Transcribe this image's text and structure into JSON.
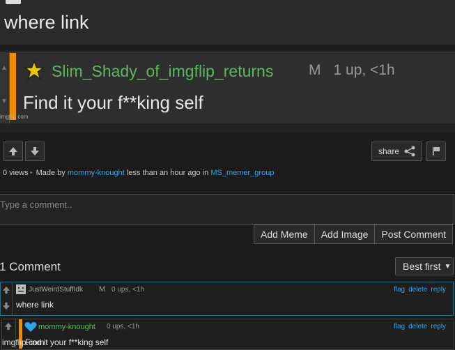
{
  "meme": {
    "top_text": "where link",
    "comment_user": "Slim_Shady_of_imgflip_returns",
    "comment_mod": "M",
    "comment_meta": "1 up, <1h",
    "comment_text": "Find it your f**king self",
    "watermark": "imgflip.com"
  },
  "actions": {
    "share_label": "share"
  },
  "meta": {
    "views": "0 views",
    "made_by_prefix": "Made by",
    "author": "mommy-knought",
    "time": "less than an hour ago in",
    "stream": "MS_memer_group"
  },
  "comment_box": {
    "placeholder": "Type a comment..",
    "buttons": [
      "Add Meme",
      "Add Image",
      "Post Comment"
    ]
  },
  "comments_header": {
    "count_label": "1 Comment",
    "sort_label": "Best first"
  },
  "comments": [
    {
      "user": "JustWeirdStuffIdk",
      "mod": "M",
      "meta": "0 ups, <1h",
      "text": "where link",
      "actions": [
        "flag",
        "delete",
        "reply"
      ]
    },
    {
      "user": "mommy-knought",
      "meta": "0 ups, <1h",
      "text": "Find it your f**king self",
      "watermark": "imgflip.com",
      "actions": [
        "flag",
        "delete",
        "reply"
      ]
    }
  ],
  "colors": {
    "accent_orange": "#f08a00",
    "link_blue": "#3ba0e0",
    "username_green": "#5cb85c"
  }
}
